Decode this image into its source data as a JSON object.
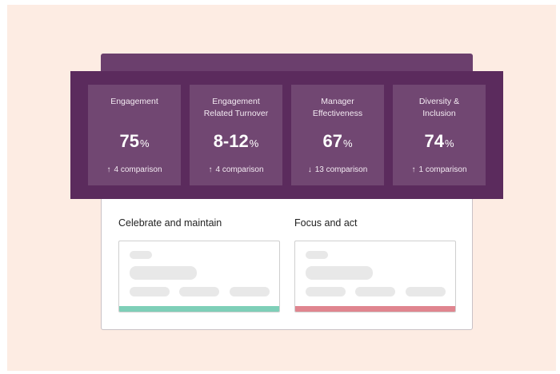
{
  "metrics": [
    {
      "label": "Engagement",
      "value": "75",
      "unit": "%",
      "arrow": "↑",
      "comparison": "4 comparison"
    },
    {
      "label": "Engagement\nRelated Turnover",
      "value": "8-12",
      "unit": "%",
      "arrow": "↑",
      "comparison": "4 comparison"
    },
    {
      "label": "Manager\nEffectiveness",
      "value": "67",
      "unit": "%",
      "arrow": "↓",
      "comparison": "13 comparison"
    },
    {
      "label": "Diversity &\nInclusion",
      "value": "74",
      "unit": "%",
      "arrow": "↑",
      "comparison": "1 comparison"
    }
  ],
  "sections": {
    "celebrate": {
      "title": "Celebrate and maintain",
      "accent": "#7ecfb8"
    },
    "focus": {
      "title": "Focus and act",
      "accent": "#e0858f"
    }
  },
  "icons": {
    "up": "arrow-up-icon",
    "down": "arrow-down-icon"
  },
  "colors": {
    "background": "#fdece3",
    "panel": "#5b2b5d",
    "tile": "#714772"
  }
}
